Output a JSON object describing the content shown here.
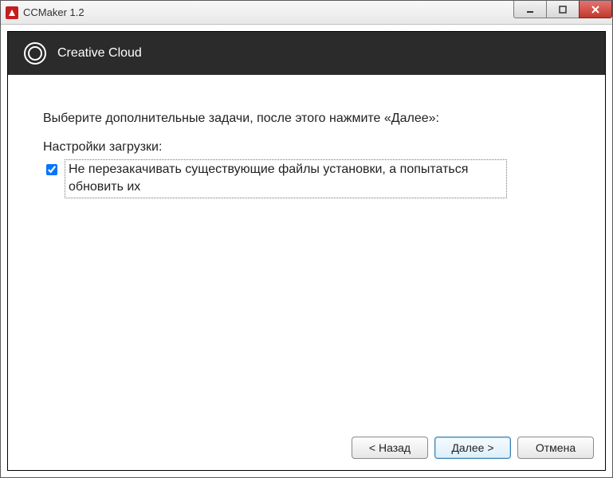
{
  "window": {
    "title": "CCMaker 1.2"
  },
  "header": {
    "title": "Creative Cloud"
  },
  "main": {
    "instruction": "Выберите дополнительные задачи, после этого нажмите «Далее»:",
    "download_settings_label": "Настройки загрузки:",
    "option1_checked": true,
    "option1_text": "Не перезакачивать существующие файлы установки, а попытаться обновить их"
  },
  "footer": {
    "back_label": "< Назад",
    "next_label": "Далее >",
    "cancel_label": "Отмена"
  }
}
